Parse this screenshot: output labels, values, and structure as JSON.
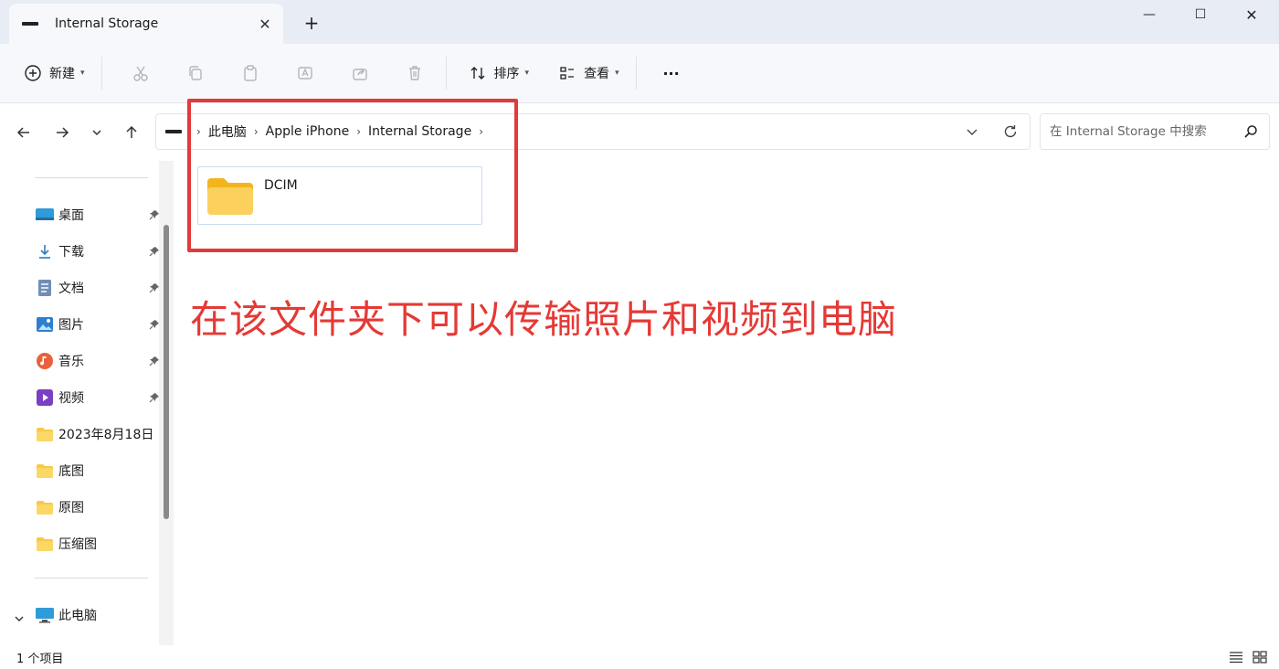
{
  "window": {
    "tab_title": "Internal Storage",
    "new_tab_symbol": "+",
    "close_tab_symbol": "✕",
    "minimize_symbol": "—",
    "maximize_symbol": "☐",
    "close_symbol": "✕"
  },
  "toolbar": {
    "new_label": "新建",
    "sort_label": "排序",
    "view_label": "查看",
    "more_label": "···"
  },
  "navigation": {
    "breadcrumb": [
      "此电脑",
      "Apple iPhone",
      "Internal Storage"
    ],
    "search_placeholder": "在 Internal Storage 中搜索"
  },
  "sidebar": {
    "items": [
      {
        "label": "桌面",
        "icon": "desktop-icon",
        "pinned": true
      },
      {
        "label": "下载",
        "icon": "download-icon",
        "pinned": true
      },
      {
        "label": "文档",
        "icon": "document-icon",
        "pinned": true
      },
      {
        "label": "图片",
        "icon": "picture-icon",
        "pinned": true
      },
      {
        "label": "音乐",
        "icon": "music-icon",
        "pinned": true
      },
      {
        "label": "视频",
        "icon": "video-icon",
        "pinned": true
      },
      {
        "label": "2023年8月18日",
        "icon": "folder-icon",
        "pinned": false
      },
      {
        "label": "底图",
        "icon": "folder-icon",
        "pinned": false
      },
      {
        "label": "原图",
        "icon": "folder-icon",
        "pinned": false
      },
      {
        "label": "压缩图",
        "icon": "folder-icon",
        "pinned": false
      }
    ],
    "this_pc_label": "此电脑"
  },
  "content": {
    "folders": [
      {
        "name": "DCIM"
      }
    ],
    "annotation": "在该文件夹下可以传输照片和视频到电脑"
  },
  "status": {
    "item_count": "1 个项目"
  },
  "colors": {
    "accent_red": "#e53935",
    "folder_yellow": "#f7c948",
    "selection_border": "#c7dcf0"
  }
}
